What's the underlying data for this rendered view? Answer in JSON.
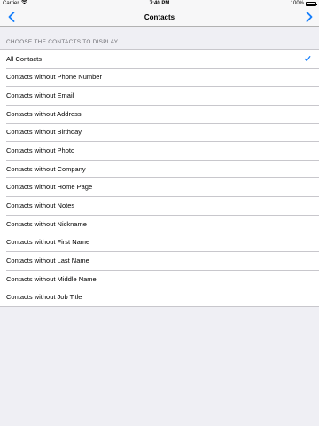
{
  "status_bar": {
    "carrier": "Carrier",
    "time": "7:40 PM",
    "battery": "100%"
  },
  "nav": {
    "title": "Contacts",
    "back_icon": "chevron-left-icon",
    "forward_icon": "chevron-right-icon",
    "tint": "#147efb"
  },
  "section": {
    "header": "CHOOSE THE CONTACTS TO DISPLAY"
  },
  "options": [
    {
      "label": "All Contacts",
      "selected": true
    },
    {
      "label": "Contacts without Phone Number",
      "selected": false
    },
    {
      "label": "Contacts without Email",
      "selected": false
    },
    {
      "label": "Contacts without Address",
      "selected": false
    },
    {
      "label": "Contacts without Birthday",
      "selected": false
    },
    {
      "label": "Contacts without Photo",
      "selected": false
    },
    {
      "label": "Contacts without Company",
      "selected": false
    },
    {
      "label": "Contacts without Home Page",
      "selected": false
    },
    {
      "label": "Contacts without Notes",
      "selected": false
    },
    {
      "label": "Contacts without Nickname",
      "selected": false
    },
    {
      "label": "Contacts without First Name",
      "selected": false
    },
    {
      "label": "Contacts without Last Name",
      "selected": false
    },
    {
      "label": "Contacts without Middle Name",
      "selected": false
    },
    {
      "label": "Contacts without Job Title",
      "selected": false
    }
  ]
}
